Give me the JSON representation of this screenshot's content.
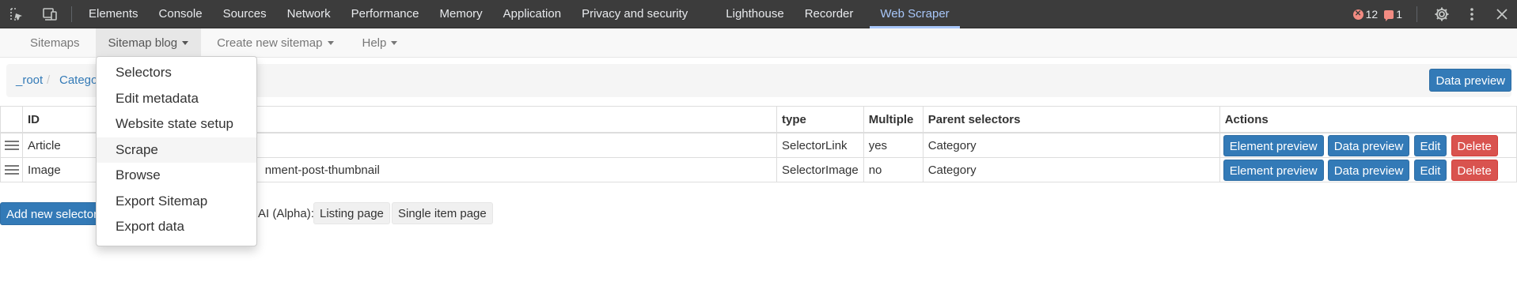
{
  "devtools": {
    "tabs": [
      "Elements",
      "Console",
      "Sources",
      "Network",
      "Performance",
      "Memory",
      "Application",
      "Privacy and security",
      "Lighthouse",
      "Recorder",
      "Web Scraper"
    ],
    "errors_count": "12",
    "issues_count": "1",
    "colors": {
      "bar": "#3c3c3c",
      "active_tab": "#a8c7fa",
      "error": "#f28b82"
    }
  },
  "nav": {
    "sitemaps": "Sitemaps",
    "sitemap_blog": "Sitemap blog",
    "create_new_sitemap": "Create new sitemap",
    "help": "Help"
  },
  "breadcrumb": {
    "root": "_root",
    "separator": "/",
    "category": "Category"
  },
  "top_data_preview": "Data preview",
  "table": {
    "headers": [
      "ID",
      "type",
      "Multiple",
      "Parent selectors",
      "Actions"
    ],
    "rows": [
      {
        "id": "Article",
        "selector": "",
        "type": "SelectorLink",
        "multiple": "yes",
        "parent": "Category"
      },
      {
        "id": "Image",
        "selector": "nment-post-thumbnail",
        "type": "SelectorImage",
        "multiple": "no",
        "parent": "Category"
      }
    ],
    "actions": {
      "element_preview": "Element preview",
      "data_preview": "Data preview",
      "edit": "Edit",
      "delete": "Delete"
    }
  },
  "bottom": {
    "add_new_selector": "Add new selector",
    "ai_label": "AI (Alpha):",
    "listing_page": "Listing page",
    "single_item_page": "Single item page"
  },
  "dropdown": {
    "items": [
      "Selectors",
      "Edit metadata",
      "Website state setup",
      "Scrape",
      "Browse",
      "Export Sitemap",
      "Export data"
    ],
    "hovered": "Scrape"
  },
  "colors": {
    "primary": "#337ab7",
    "danger": "#d9534f",
    "link": "#337ab7"
  }
}
